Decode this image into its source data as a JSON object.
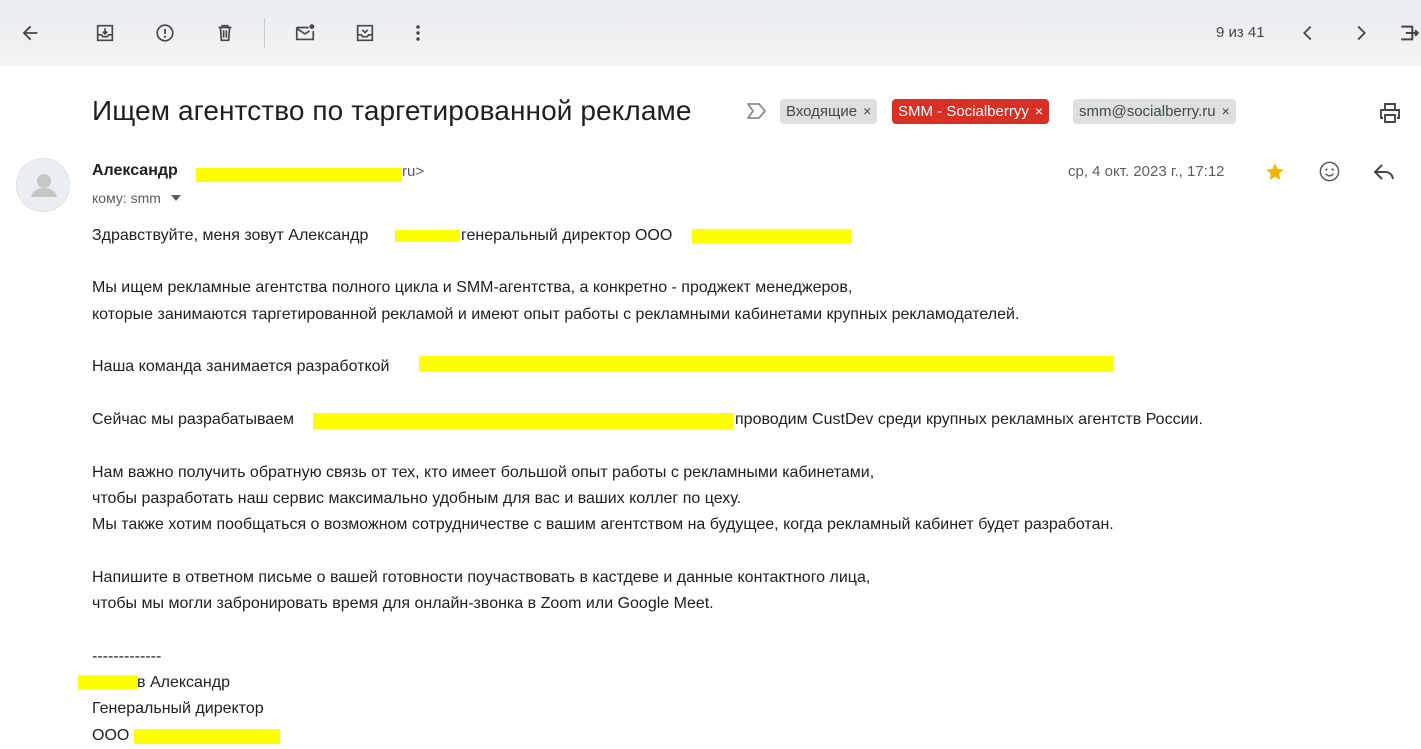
{
  "toolbar": {
    "icons": [
      "back-arrow-icon",
      "archive-icon",
      "report-spam-icon",
      "delete-icon",
      "mark-unread-icon",
      "move-to-icon",
      "more-vert-icon"
    ],
    "pager": "9 из 41"
  },
  "subject": "Ищем агентство по таргетированной рекламе",
  "labels": {
    "inbox": "Входящие",
    "smm": "SMM - Socialberryy",
    "email": "smm@socialberry.ru",
    "remove": "×"
  },
  "sender": {
    "name": "Александр",
    "email_tail": "ru>",
    "recipient": "кому: smm",
    "date": "ср, 4 окт. 2023 г., 17:12"
  },
  "body": {
    "greeting_pre": "Здравствуйте, меня зовут Александр",
    "greeting_post": "генеральный директор ООО",
    "para1_line1": "Мы ищем рекламные агентства полного цикла и SMM-агентства, а конкретно - проджект менеджеров,",
    "para1_line2": "которые занимаются таргетированной рекламой и имеют опыт работы с рекламными кабинетами крупных рекламодателей.",
    "para2_pre": "Наша команда занимается разработкой",
    "para3_pre": "Сейчас мы разрабатываем",
    "para3_post": "проводим CustDev среди крупных рекламных агентств России.",
    "para4_line1": "Нам важно получить обратную связь от тех, кто имеет большой опыт работы с рекламными кабинетами,",
    "para4_line2": "чтобы разработать наш сервис максимально удобным для вас и ваших коллег по цеху.",
    "para4_line3": "Мы также хотим пообщаться о возможном сотрудничестве с вашим агентством на будущее, когда рекламный кабинет будет разработан.",
    "para5_line1": "Напишите в ответном письме о вашей готовности поучаствовать в кастдеве и данные контактного лица,",
    "para5_line2": "чтобы мы могли забронировать время для онлайн-звонка в Zoom или Google Meet.",
    "sig_sep": "-------------",
    "sig_name": "в Александр",
    "sig_title": "Генеральный директор",
    "sig_company": "ООО"
  }
}
